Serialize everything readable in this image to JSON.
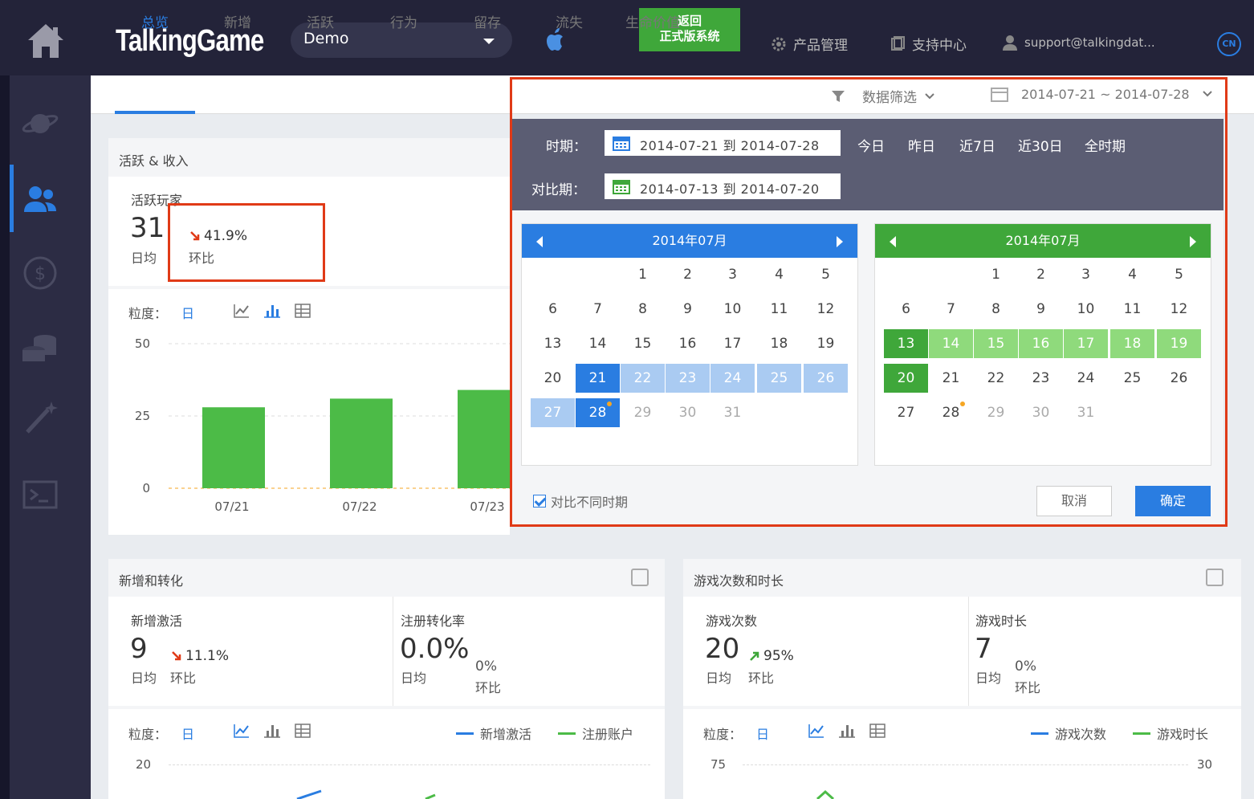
{
  "header": {
    "brand": "TalkingGame",
    "app_select": "Demo",
    "back_button": [
      "返回",
      "正式版系统"
    ],
    "product_mgmt": "产品管理",
    "support": "支持中心",
    "account": "support@talkingdat...",
    "lang": "CN"
  },
  "tabs": [
    "总览",
    "新增",
    "活跃",
    "行为",
    "留存",
    "流失",
    "生命价值"
  ],
  "filters": {
    "data_filter": "数据筛选",
    "date_range": "2014-07-21 ~ 2014-07-28"
  },
  "active_card": {
    "title": "活跃 & 收入",
    "metric_label": "活跃玩家",
    "value": "31",
    "value_sub": "日均",
    "change": "41.9%",
    "change_sub": "环比",
    "change_direction": "down",
    "granularity_label": "粒度：",
    "granularity_value": "日"
  },
  "chart_data": {
    "type": "bar",
    "categories": [
      "07/21",
      "07/22",
      "07/23"
    ],
    "values": [
      28,
      31,
      34
    ],
    "ylim": [
      0,
      50
    ],
    "yticks": [
      0,
      25,
      50
    ],
    "color": "#4cbb47",
    "grid": true
  },
  "picker": {
    "period_label": "时期：",
    "period_value": "2014-07-21 到 2014-07-28",
    "compare_label": "对比期：",
    "compare_value": "2014-07-13 到 2014-07-20",
    "quick": [
      "今日",
      "昨日",
      "近7日",
      "近30日",
      "全时期"
    ],
    "month_left": "2014年07月",
    "month_right": "2014年07月",
    "compare_checkbox": "对比不同时期",
    "cancel": "取消",
    "ok": "确定",
    "accent_blue": "#2a7de1",
    "accent_green": "#3fa73a"
  },
  "new_card": {
    "title": "新增和转化",
    "m1_label": "新增激活",
    "m1_value": "9",
    "m1_sub": "日均",
    "m1_change": "11.1%",
    "m1_change_sub": "环比",
    "m1_direction": "down",
    "m2_label": "注册转化率",
    "m2_value": "0.0%",
    "m2_sub": "日均",
    "m2_change": "0%",
    "m2_change_sub": "环比",
    "granularity_label": "粒度：",
    "granularity_value": "日",
    "legend": [
      "新增激活",
      "注册账户"
    ],
    "ytick_top": "20"
  },
  "game_card": {
    "title": "游戏次数和时长",
    "m1_label": "游戏次数",
    "m1_value": "20",
    "m1_sub": "日均",
    "m1_change": "95%",
    "m1_change_sub": "环比",
    "m1_direction": "up",
    "m2_label": "游戏时长",
    "m2_value": "7",
    "m2_sub": "日均",
    "m2_change": "0%",
    "m2_change_sub": "环比",
    "granularity_label": "粒度：",
    "granularity_value": "日",
    "legend": [
      "游戏次数",
      "游戏时长"
    ],
    "ytick_left": "75",
    "ytick_right": "30"
  }
}
